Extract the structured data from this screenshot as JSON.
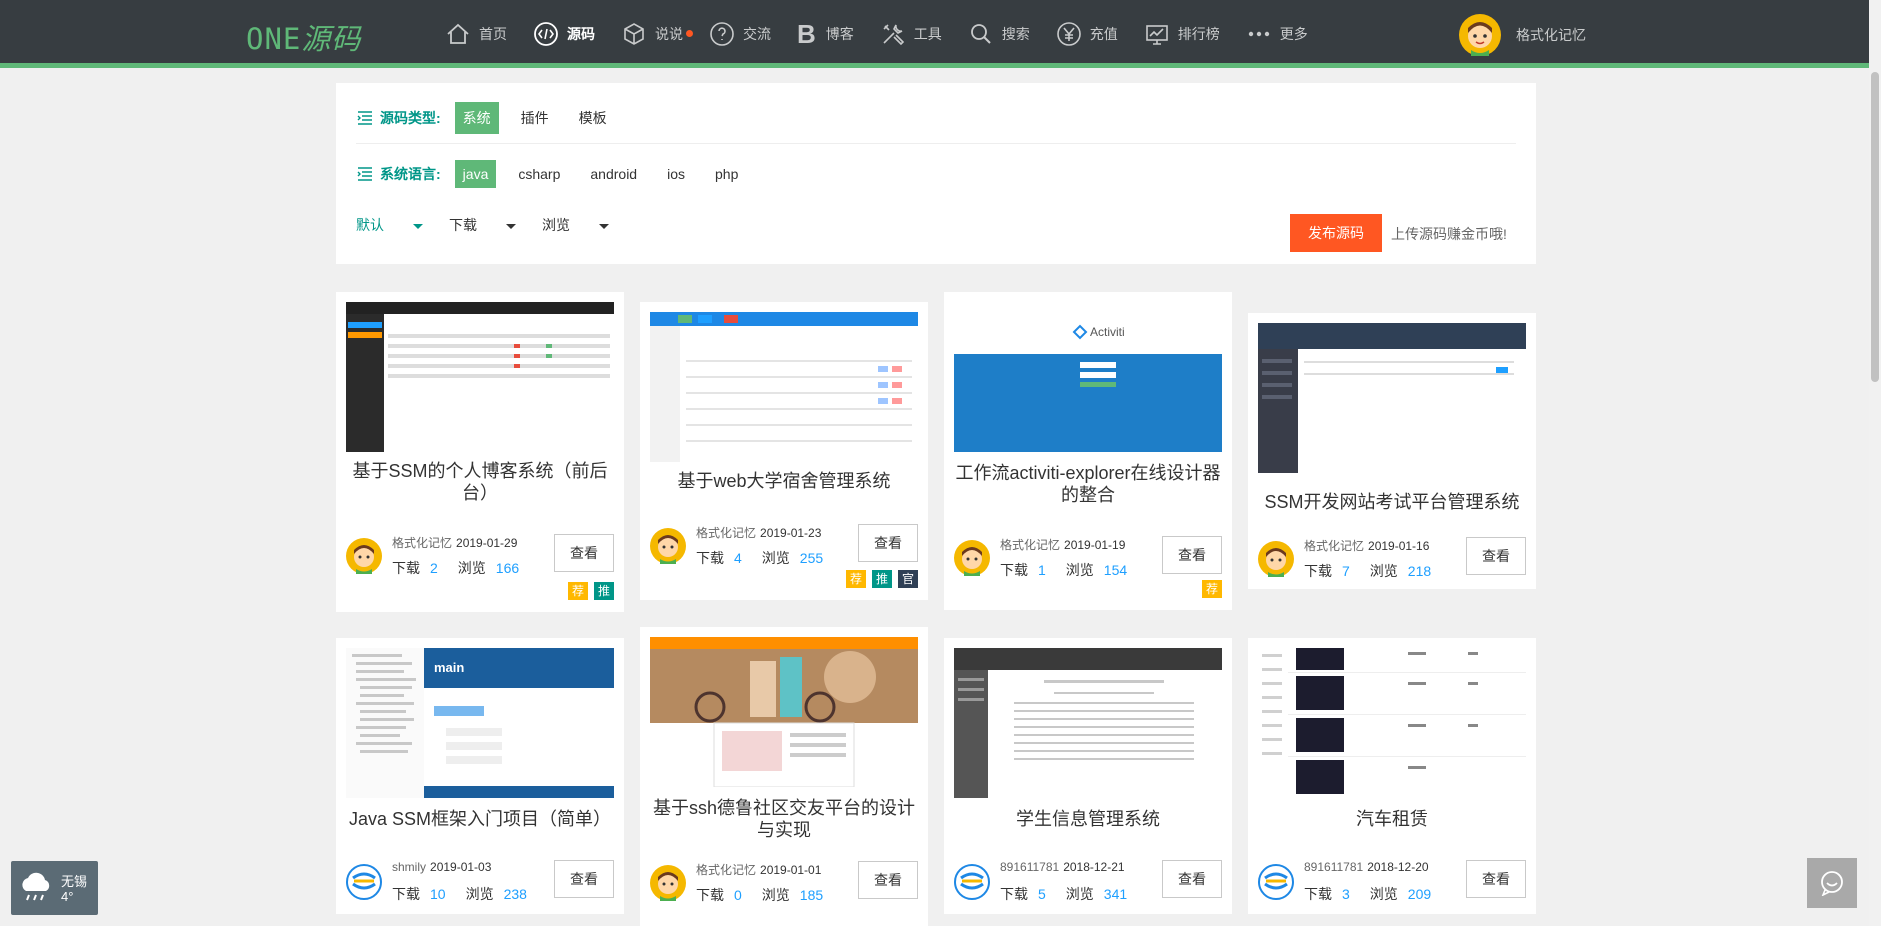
{
  "nav": {
    "logo_latin": "ONE",
    "logo_zh": "源码",
    "items": [
      {
        "label": "首页",
        "icon": "home-icon"
      },
      {
        "label": "源码",
        "icon": "code-icon",
        "active": true
      },
      {
        "label": "说说",
        "icon": "cube-icon",
        "dot": true
      },
      {
        "label": "交流",
        "icon": "question-icon"
      },
      {
        "label": "博客",
        "icon": "blog-b-icon"
      },
      {
        "label": "工具",
        "icon": "tools-icon"
      },
      {
        "label": "搜索",
        "icon": "search-icon"
      },
      {
        "label": "充值",
        "icon": "yen-icon"
      },
      {
        "label": "排行榜",
        "icon": "rank-board-icon"
      },
      {
        "label": "更多",
        "icon": "more-dots-icon"
      }
    ],
    "user": "格式化记忆"
  },
  "filter": {
    "type_label": "源码类型:",
    "types": [
      "系统",
      "插件",
      "模板"
    ],
    "lang_label": "系统语言:",
    "langs": [
      "java",
      "csharp",
      "android",
      "ios",
      "php"
    ],
    "sorts": [
      "默认",
      "下载",
      "浏览"
    ],
    "publish": "发布源码",
    "publish_tip": "上传源码赚金币哦!"
  },
  "card_labels": {
    "download": "下载",
    "browse": "浏览",
    "view": "查看"
  },
  "cards": [
    {
      "title": "基于SSM的个人博客系统（前后台）",
      "author": "格式化记忆",
      "date": "2019-01-29",
      "downloads": "2",
      "views": "166",
      "badges": [
        "荐",
        "推"
      ]
    },
    {
      "title": "基于web大学宿舍管理系统",
      "author": "格式化记忆",
      "date": "2019-01-23",
      "downloads": "4",
      "views": "255",
      "badges": [
        "荐",
        "推",
        "官"
      ]
    },
    {
      "title": "工作流activiti-explorer在线设计器的整合",
      "author": "格式化记忆",
      "date": "2019-01-19",
      "downloads": "1",
      "views": "154",
      "badges": [
        "荐"
      ]
    },
    {
      "title": "SSM开发网站考试平台管理系统",
      "author": "格式化记忆",
      "date": "2019-01-16",
      "downloads": "7",
      "views": "218",
      "badges": []
    },
    {
      "title": "Java SSM框架入门项目（简单）",
      "author": "shmily",
      "date": "2019-01-03",
      "downloads": "10",
      "views": "238",
      "badges": []
    },
    {
      "title": "基于ssh德鲁社区交友平台的设计与实现",
      "author": "格式化记忆",
      "date": "2019-01-01",
      "downloads": "0",
      "views": "185",
      "badges": []
    },
    {
      "title": "学生信息管理系统",
      "author": "891611781",
      "date": "2018-12-21",
      "downloads": "5",
      "views": "341",
      "badges": []
    },
    {
      "title": "汽车租赁",
      "author": "891611781",
      "date": "2018-12-20",
      "downloads": "3",
      "views": "209",
      "badges": []
    }
  ],
  "thumb_text": {
    "activiti": "Activiti",
    "main": "main"
  },
  "weather": {
    "city": "无锡",
    "temp": "4°"
  },
  "colors": {
    "nav_bg": "#373d41",
    "accent_green": "#5fb878",
    "teal": "#009688",
    "orange": "#ff5722",
    "blue_num": "#1e9fff"
  }
}
